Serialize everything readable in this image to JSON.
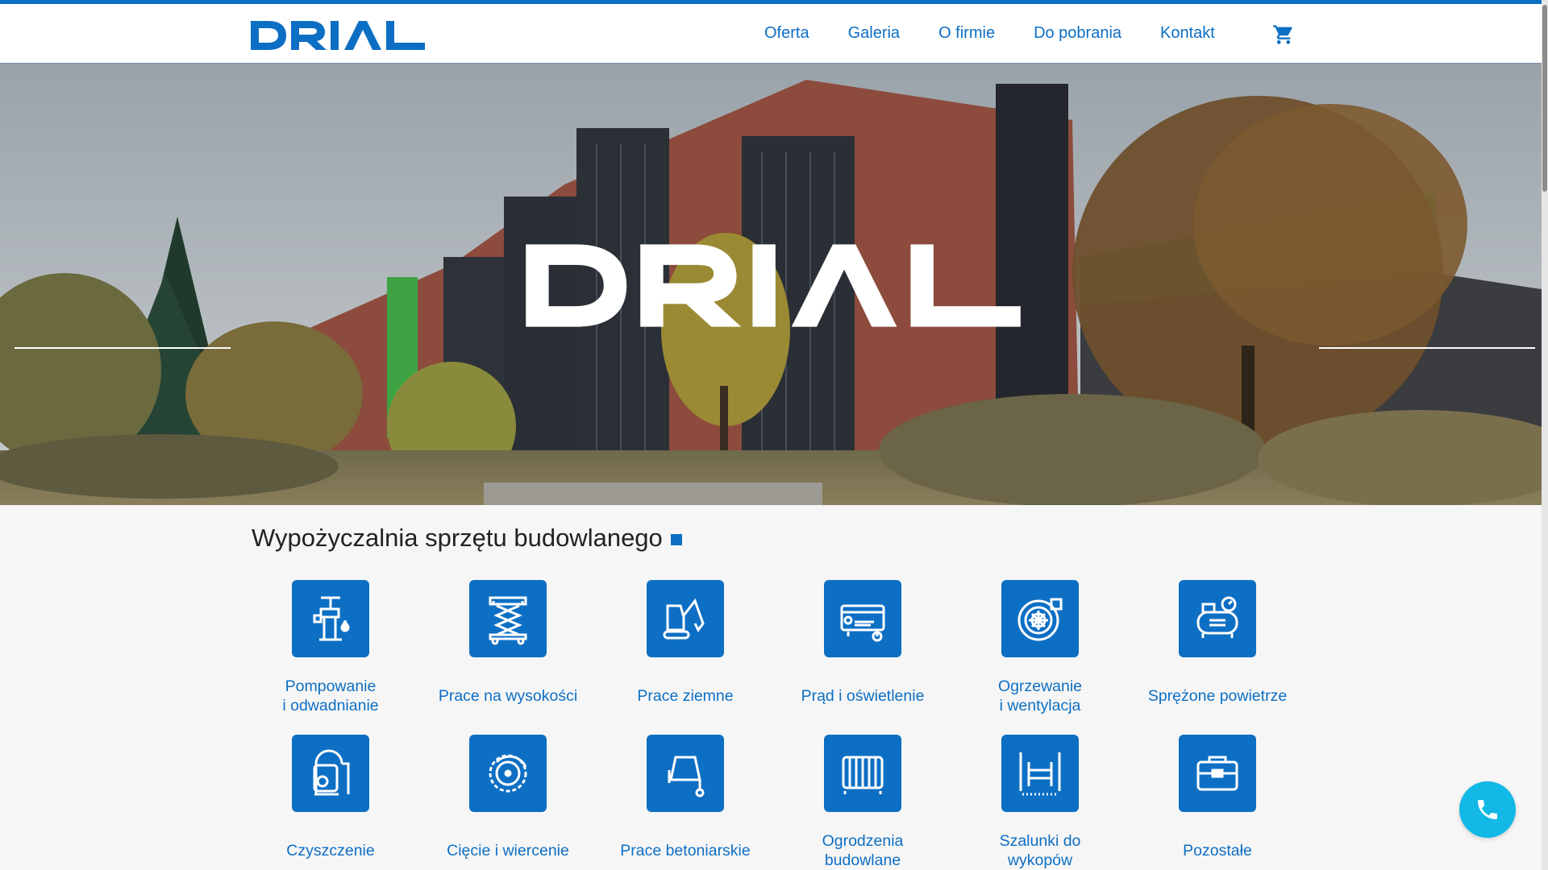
{
  "brand": {
    "logo_text": "DRIAL",
    "accent_color": "#0d6fc4",
    "phone_color": "#12b8e6"
  },
  "nav": {
    "items": [
      {
        "label": "Oferta"
      },
      {
        "label": "Galeria"
      },
      {
        "label": "O firmie"
      },
      {
        "label": "Do pobrania"
      },
      {
        "label": "Kontakt"
      }
    ],
    "cart_icon": "cart-icon"
  },
  "hero": {
    "overlay_text": "DRIAL",
    "image": "photo of brick office building with autumn trees"
  },
  "section": {
    "title": "Wypożyczalnia sprzętu budowlanego"
  },
  "categories": [
    {
      "line1": "Pompowanie",
      "line2": "i odwadnianie",
      "icon": "water-pump-icon"
    },
    {
      "line1": "Prace na wysokości",
      "line2": "",
      "icon": "scissor-lift-icon"
    },
    {
      "line1": "Prace ziemne",
      "line2": "",
      "icon": "mini-excavator-icon"
    },
    {
      "line1": "Prąd i oświetlenie",
      "line2": "",
      "icon": "generator-icon"
    },
    {
      "line1": "Ogrzewanie",
      "line2": "i wentylacja",
      "icon": "heater-fan-icon"
    },
    {
      "line1": "Sprężone powietrze",
      "line2": "",
      "icon": "air-compressor-icon"
    },
    {
      "line1": "Czyszczenie",
      "line2": "",
      "icon": "cleaner-icon"
    },
    {
      "line1": "Cięcie i wiercenie",
      "line2": "",
      "icon": "saw-blade-icon"
    },
    {
      "line1": "Prace betoniarskie",
      "line2": "",
      "icon": "concrete-mixer-icon"
    },
    {
      "line1": "Ogrodzenia",
      "line2": "budowlane",
      "icon": "fence-icon"
    },
    {
      "line1": "Szalunki do",
      "line2": "wykopów",
      "icon": "trench-shoring-icon"
    },
    {
      "line1": "Pozostałe",
      "line2": "",
      "icon": "toolbox-icon"
    }
  ],
  "phone_button": {
    "icon": "phone-icon"
  }
}
